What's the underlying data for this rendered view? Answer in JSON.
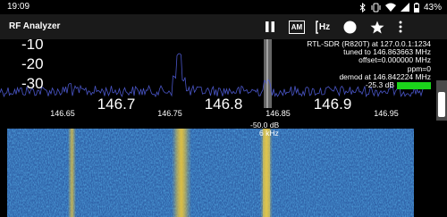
{
  "status_bar": {
    "time": "19:09",
    "battery_pct": "43%",
    "icons": [
      "bluetooth-icon",
      "vibrate-icon",
      "wifi-icon",
      "signal-icon",
      "battery-icon"
    ]
  },
  "app_bar": {
    "title": "RF Analyzer",
    "am_label": "AM",
    "hz_label": "Hz",
    "icons": [
      "pause-icon",
      "demodulation-am-icon",
      "frequency-hz-icon",
      "record-icon",
      "bookmark-star-icon",
      "overflow-menu-icon"
    ]
  },
  "spectrum": {
    "db_labels": [
      "-10",
      "-20",
      "-30"
    ],
    "info_lines": [
      "RTL-SDR (R820T) at 127.0.0.1:1234",
      "tuned to 146.863663 MHz",
      "offset=0.000000 MHz",
      "ppm=0",
      "demod at 146.842224 MHz"
    ],
    "signal_db": "-25.3 dB",
    "signal_color": "#1bd41b"
  },
  "frequency_axis": {
    "major": [
      "146.7",
      "146.8",
      "146.9"
    ],
    "minor": [
      "146.65",
      "146.75",
      "146.85",
      "146.95"
    ]
  },
  "waterfall": {
    "db_label": "-50.0 dB",
    "bandwidth_label": "6 kHz"
  },
  "colors": {
    "waterfall_base": "#2f62a8",
    "signal_yellow": "#e8c43a",
    "toolbar_bg": "#1a1a1a"
  }
}
